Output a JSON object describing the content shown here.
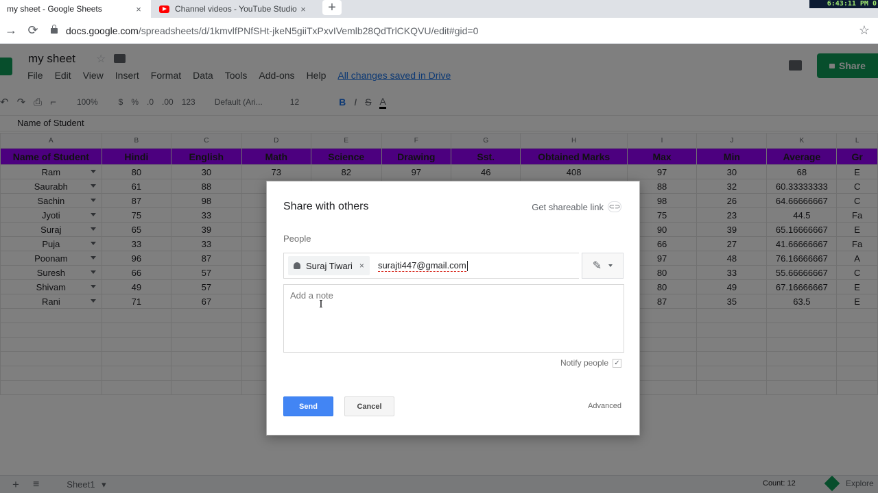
{
  "browser": {
    "tabs": [
      {
        "title": "my sheet - Google Sheets",
        "close": "×"
      },
      {
        "title": "Channel videos - YouTube Studio",
        "close": "×"
      }
    ],
    "new_tab": "+",
    "clock": "6:43:11 PM 0",
    "url_host": "docs.google.com",
    "url_path": "/spreadsheets/d/1kmvlfPNfSHt-jkeN5giiTxPxvIVemlb28QdTrlCKQVU/edit#gid=0",
    "back": "←",
    "forward": "→",
    "reload": "⟳",
    "bookmark": "☆"
  },
  "sheets": {
    "doc_title": "my sheet",
    "star": "☆",
    "menu": [
      "File",
      "Edit",
      "View",
      "Insert",
      "Format",
      "Data",
      "Tools",
      "Add-ons",
      "Help"
    ],
    "saved_status": "All changes saved in Drive",
    "share_label": "Share",
    "toolbar": {
      "undo": "↶",
      "redo": "↷",
      "print": "⎙",
      "paint": "⌐",
      "zoom": "100%",
      "currency": "$",
      "percent": "%",
      "dec_less": ".0",
      "dec_more": ".00",
      "more_formats": "123",
      "font": "Default (Ari...",
      "font_size": "12",
      "bold": "B",
      "italic": "I",
      "strike": "S",
      "text_color": "A"
    },
    "formula_bar": "Name of Student",
    "columns": [
      "A",
      "B",
      "C",
      "D",
      "E",
      "F",
      "G",
      "H",
      "I",
      "J",
      "K",
      "L"
    ],
    "header_row": [
      "Name of Student",
      "Hindi",
      "English",
      "Math",
      "Science",
      "Drawing",
      "Sst.",
      "Obtained Marks",
      "Max",
      "Min",
      "Average",
      "Gr"
    ],
    "rows": [
      [
        "Ram",
        "80",
        "30",
        "73",
        "82",
        "97",
        "46",
        "408",
        "97",
        "30",
        "68",
        "E"
      ],
      [
        "Saurabh",
        "61",
        "88",
        "",
        "",
        "",
        "",
        "",
        "88",
        "32",
        "60.33333333",
        "C"
      ],
      [
        "Sachin",
        "87",
        "98",
        "",
        "",
        "",
        "",
        "",
        "98",
        "26",
        "64.66666667",
        "C"
      ],
      [
        "Jyoti",
        "75",
        "33",
        "",
        "",
        "",
        "",
        "",
        "75",
        "23",
        "44.5",
        "Fa"
      ],
      [
        "Suraj",
        "65",
        "39",
        "",
        "",
        "",
        "",
        "",
        "90",
        "39",
        "65.16666667",
        "E"
      ],
      [
        "Puja",
        "33",
        "33",
        "",
        "",
        "",
        "",
        "",
        "66",
        "27",
        "41.66666667",
        "Fa"
      ],
      [
        "Poonam",
        "96",
        "87",
        "",
        "",
        "",
        "",
        "",
        "97",
        "48",
        "76.16666667",
        "A"
      ],
      [
        "Suresh",
        "66",
        "57",
        "",
        "",
        "",
        "",
        "",
        "80",
        "33",
        "55.66666667",
        "C"
      ],
      [
        "Shivam",
        "49",
        "57",
        "",
        "",
        "",
        "",
        "",
        "80",
        "49",
        "67.16666667",
        "E"
      ],
      [
        "Rani",
        "71",
        "67",
        "",
        "",
        "",
        "",
        "",
        "87",
        "35",
        "63.5",
        "E"
      ]
    ],
    "add_sheet": "+",
    "all_sheets": "≡",
    "sheet_tab": "Sheet1",
    "sheet_tab_menu": "▾",
    "count": "Count: 12",
    "explore": "Explore"
  },
  "dialog": {
    "title": "Share with others",
    "shareable_link": "Get shareable link",
    "link_icon": "⊂⊃",
    "people_label": "People",
    "chip_name": "Suraj Tiwari",
    "chip_remove": "×",
    "typed_email": "surajti447@gmail.com",
    "edit_icon": "✎",
    "note_placeholder": "Add a note",
    "text_cursor": "I",
    "notify_label": "Notify people",
    "notify_check": "✓",
    "send": "Send",
    "cancel": "Cancel",
    "advanced": "Advanced"
  },
  "colors": {
    "header_fill": "#9900ff",
    "share_green": "#0f9d58",
    "send_blue": "#4285f4"
  }
}
